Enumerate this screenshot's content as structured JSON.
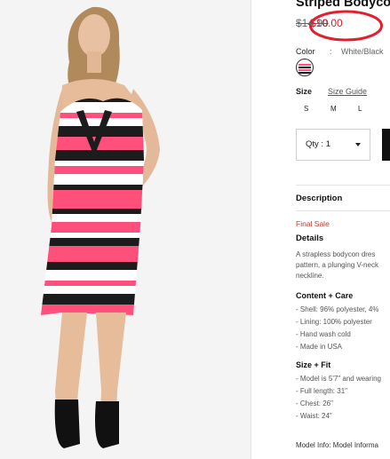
{
  "product": {
    "title": "Striped Bodycon",
    "old_price": "$14.90",
    "new_price": "$10.00"
  },
  "color": {
    "label": "Color",
    "separator": ":",
    "value": "White/Black"
  },
  "size": {
    "label": "Size",
    "guide_link": "Size Guide",
    "options": [
      "S",
      "M",
      "L"
    ]
  },
  "quantity": {
    "label": "Qty : 1"
  },
  "description": {
    "heading": "Description",
    "final_sale": "Final Sale",
    "details_heading": "Details",
    "details_lines": [
      "A strapless bodycon dres",
      "pattern, a plunging V-neck",
      "neckline."
    ],
    "content_care_heading": "Content + Care",
    "content_care_items": [
      "- Shell: 96% polyester, 4%",
      "- Lining: 100% polyester",
      "- Hand wash cold",
      "- Made in USA"
    ],
    "size_fit_heading": "Size + Fit",
    "size_fit_items": [
      "- Model is 5'7\" and wearing",
      "- Full length: 31\"",
      "- Chest: 26\"",
      "- Waist: 24\""
    ],
    "model_info": "Model Info: Model Informa"
  },
  "colors": {
    "sale_red": "#d61f2c",
    "annotation_red": "#e02030",
    "stripe_pink": "#ff4f7b",
    "stripe_black": "#1c1c1c"
  }
}
